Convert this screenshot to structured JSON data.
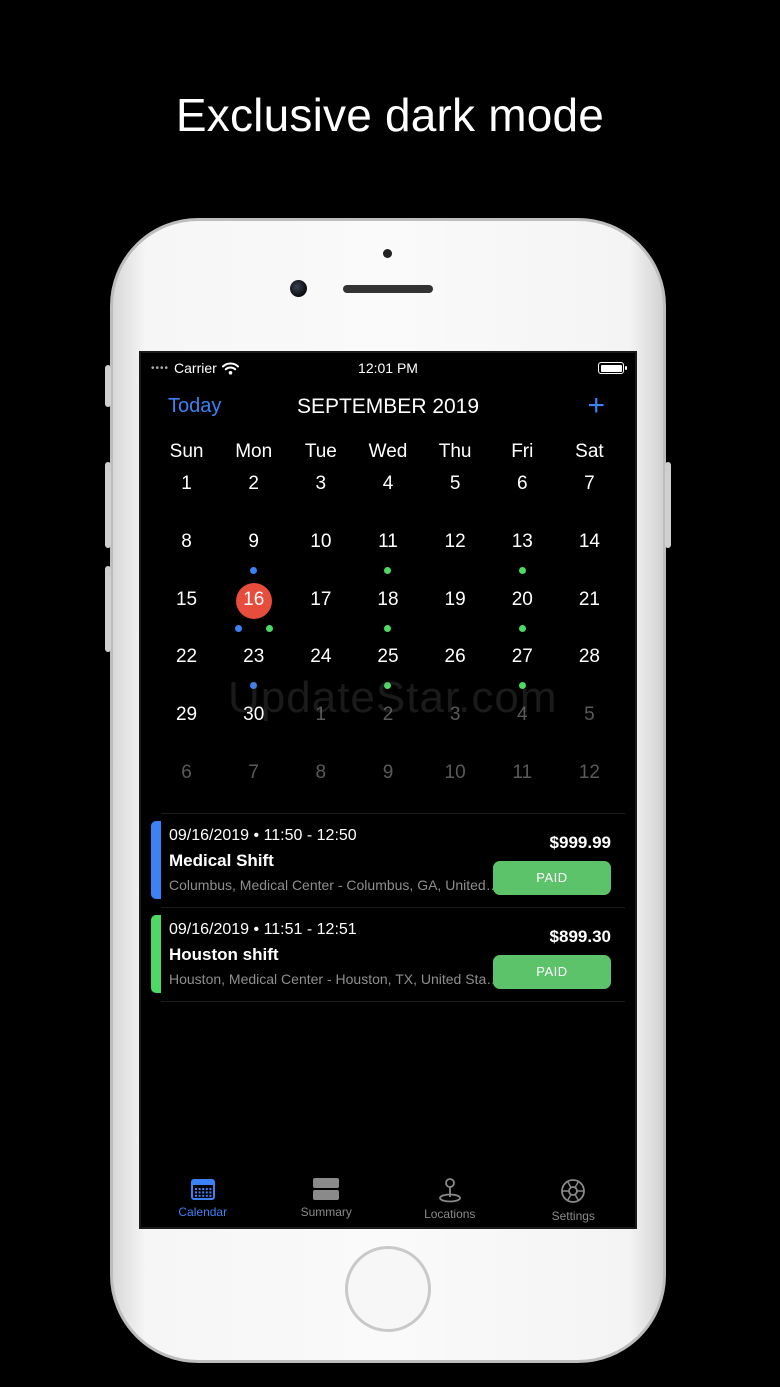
{
  "headline": "Exclusive dark mode",
  "status_bar": {
    "dots": "••••",
    "carrier": "Carrier",
    "time": "12:01 PM"
  },
  "nav": {
    "today": "Today",
    "title": "SEPTEMBER 2019",
    "add": "+"
  },
  "weekdays": [
    "Sun",
    "Mon",
    "Tue",
    "Wed",
    "Thu",
    "Fri",
    "Sat"
  ],
  "weeks": [
    [
      {
        "d": "1"
      },
      {
        "d": "2"
      },
      {
        "d": "3"
      },
      {
        "d": "4"
      },
      {
        "d": "5"
      },
      {
        "d": "6"
      },
      {
        "d": "7"
      }
    ],
    [
      {
        "d": "8"
      },
      {
        "d": "9",
        "dots": [
          "blue"
        ]
      },
      {
        "d": "10"
      },
      {
        "d": "11",
        "dots": [
          "green"
        ]
      },
      {
        "d": "12"
      },
      {
        "d": "13",
        "dots": [
          "green"
        ]
      },
      {
        "d": "14"
      }
    ],
    [
      {
        "d": "15"
      },
      {
        "d": "16",
        "today": true,
        "dots": [
          "blue",
          "green"
        ]
      },
      {
        "d": "17"
      },
      {
        "d": "18",
        "dots": [
          "green"
        ]
      },
      {
        "d": "19"
      },
      {
        "d": "20",
        "dots": [
          "green"
        ]
      },
      {
        "d": "21"
      }
    ],
    [
      {
        "d": "22"
      },
      {
        "d": "23",
        "dots": [
          "blue"
        ]
      },
      {
        "d": "24"
      },
      {
        "d": "25",
        "dots": [
          "green"
        ]
      },
      {
        "d": "26"
      },
      {
        "d": "27",
        "dots": [
          "green"
        ]
      },
      {
        "d": "28"
      }
    ],
    [
      {
        "d": "29"
      },
      {
        "d": "30"
      },
      {
        "d": "1",
        "muted": true
      },
      {
        "d": "2",
        "muted": true
      },
      {
        "d": "3",
        "muted": true
      },
      {
        "d": "4",
        "muted": true
      },
      {
        "d": "5",
        "muted": true
      }
    ],
    [
      {
        "d": "6",
        "muted": true
      },
      {
        "d": "7",
        "muted": true
      },
      {
        "d": "8",
        "muted": true
      },
      {
        "d": "9",
        "muted": true
      },
      {
        "d": "10",
        "muted": true
      },
      {
        "d": "11",
        "muted": true
      },
      {
        "d": "12",
        "muted": true
      }
    ]
  ],
  "watermark": "UpdateStar.com",
  "events": [
    {
      "color": "#3b82f6",
      "date": "09/16/2019 • 11:50 - 12:50",
      "title": "Medical Shift",
      "location": "Columbus, Medical Center - Columbus, GA, United States",
      "amount": "$999.99",
      "status": "PAID"
    },
    {
      "color": "#4cd964",
      "date": "09/16/2019 • 11:51 - 12:51",
      "title": "Houston shift",
      "location": "Houston, Medical Center - Houston, TX, United States",
      "amount": "$899.30",
      "status": "PAID"
    }
  ],
  "tabs": [
    {
      "label": "Calendar",
      "icon": "calendar-icon",
      "active": true
    },
    {
      "label": "Summary",
      "icon": "summary-icon",
      "active": false
    },
    {
      "label": "Locations",
      "icon": "location-pin-icon",
      "active": false
    },
    {
      "label": "Settings",
      "icon": "gear-icon",
      "active": false
    }
  ],
  "colors": {
    "accent": "#3b82f6",
    "today": "#e74c3c",
    "paid": "#5cc36a",
    "event_green": "#4cd964"
  }
}
